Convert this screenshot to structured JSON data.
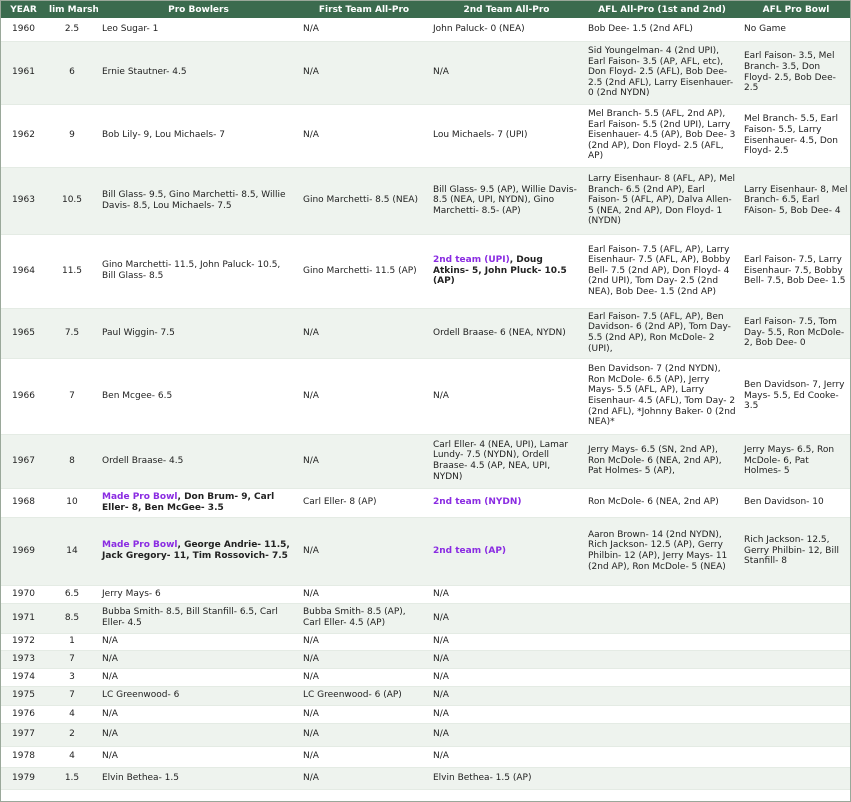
{
  "headers": [
    "YEAR",
    "lim Marshal",
    "Pro Bowlers",
    "First Team All-Pro",
    "2nd Team All-Pro",
    "AFL All-Pro (1st and 2nd)",
    "AFL Pro Bowl"
  ],
  "rows": [
    {
      "year": "1960",
      "sacks": "2.5",
      "pro_bowl": "Leo Sugar- 1",
      "first": "N/A",
      "second": "John Paluck- 0 (NEA)",
      "afl_allpro": "Bob Dee- 1.5 (2nd AFL)",
      "afl_bowl": "No Game",
      "h": 23
    },
    {
      "year": "1961",
      "sacks": "6",
      "pro_bowl": "Ernie Stautner- 4.5",
      "first": "N/A",
      "second": "N/A",
      "afl_allpro": "Sid Youngelman- 4 (2nd UPI), Earl Faison- 3.5 (AP, AFL, etc), Don Floyd- 2.5 (AFL), Bob Dee- 2.5 (2nd AFL), Larry Eisenhauer- 0 (2nd NYDN)",
      "afl_bowl": "Earl Faison- 3.5, Mel Branch- 3.5, Don Floyd- 2.5, Bob Dee- 2.5",
      "h": 63
    },
    {
      "year": "1962",
      "sacks": "9",
      "pro_bowl": "Bob Lily- 9, Lou Michaels- 7",
      "first": "N/A",
      "second": "Lou Michaels- 7 (UPI)",
      "afl_allpro": "Mel Branch- 5.5 (AFL, 2nd AP), Earl Faison- 5.5 (2nd UPI), Larry Eisenhauer- 4.5 (AP), Bob Dee- 3 (2nd AP), Don Floyd- 2.5 (AFL, AP)",
      "afl_bowl": "Mel Branch- 5.5, Earl Faison- 5.5, Larry Eisenhauer- 4.5, Don Floyd- 2.5",
      "h": 63
    },
    {
      "year": "1963",
      "sacks": "10.5",
      "pro_bowl": "Bill Glass- 9.5, Gino Marchetti- 8.5, Willie Davis- 8.5, Lou Michaels- 7.5",
      "first": "Gino Marchetti- 8.5 (NEA)",
      "second": "Bill Glass- 9.5 (AP), Willie Davis- 8.5 (NEA, UPI, NYDN), Gino Marchetti- 8.5- (AP)",
      "afl_allpro": "Larry Eisenhaur- 8 (AFL, AP), Mel Branch- 6.5 (2nd AP), Earl Faison- 5 (AFL, AP), Dalva Allen- 5 (NEA, 2nd AP), Don Floyd- 1 (NYDN)",
      "afl_bowl": "Larry Eisenhaur- 8, Mel Branch- 6.5, Earl FAison- 5, Bob Dee- 4",
      "h": 67
    },
    {
      "year": "1964",
      "sacks": "11.5",
      "pro_bowl": "Gino Marchetti- 11.5, John Paluck- 10.5, Bill Glass- 8.5",
      "first": "Gino Marchetti- 11.5 (AP)",
      "second_parts": [
        "2nd team (UPI)",
        ", Doug Atkins- 5, John Pluck- 10.5 (AP)"
      ],
      "afl_allpro": "Earl Faison- 7.5 (AFL, AP), Larry Eisenhaur- 7.5 (AFL, AP), Bobby Bell- 7.5 (2nd AP), Don Floyd- 4 (2nd UPI), Tom Day- 2.5 (2nd NEA), Bob Dee- 1.5 (2nd AP)",
      "afl_bowl": "Earl Faison- 7.5, Larry Eisenhaur- 7.5, Bobby Bell- 7.5, Bob Dee- 1.5",
      "h": 74
    },
    {
      "year": "1965",
      "sacks": "7.5",
      "pro_bowl": "Paul Wiggin- 7.5",
      "first": "N/A",
      "second": "Ordell Braase- 6 (NEA, NYDN)",
      "afl_allpro": "Earl Faison- 7.5 (AFL, AP), Ben Davidson- 6 (2nd AP), Tom Day- 5.5 (2nd AP), Ron McDole- 2 (UPI),",
      "afl_bowl": "Earl Faison- 7.5, Tom Day- 5.5, Ron McDole- 2, Bob Dee- 0",
      "h": 50
    },
    {
      "year": "1966",
      "sacks": "7",
      "pro_bowl": "Ben Mcgee- 6.5",
      "first": "N/A",
      "second": "N/A",
      "afl_allpro": "Ben Davidson- 7 (2nd NYDN), Ron McDole- 6.5 (AP), Jerry Mays- 5.5 (AFL, AP), Larry Eisenhaur- 4.5 (AFL), Tom Day- 2 (2nd AFL), *Johnny Baker- 0 (2nd NEA)*",
      "afl_bowl": "Ben Davidson- 7, Jerry Mays- 5.5, Ed Cooke- 3.5",
      "h": 76
    },
    {
      "year": "1967",
      "sacks": "8",
      "pro_bowl": "Ordell Braase- 4.5",
      "first": "N/A",
      "second": "Carl Eller- 4 (NEA, UPI), Lamar Lundy- 7.5 (NYDN), Ordell Braase- 4.5 (AP, NEA, UPI, NYDN)",
      "afl_allpro": "Jerry Mays- 6.5 (SN, 2nd AP), Ron McDole- 6 (NEA, 2nd AP), Pat Holmes- 5 (AP),",
      "afl_bowl": "Jerry Mays- 6.5, Ron McDole- 6, Pat Holmes- 5",
      "h": 54
    },
    {
      "year": "1968",
      "sacks": "10",
      "pro_bowl_parts": [
        "Made Pro Bowl",
        ", Don Brum- 9, Carl Eller- 8, Ben McGee- 3.5"
      ],
      "first": "Carl Eller- 8 (AP)",
      "second_hl": "2nd team (NYDN)",
      "afl_allpro": "Ron McDole- 6 (NEA, 2nd AP)",
      "afl_bowl": "Ben Davidson- 10",
      "h": 29
    },
    {
      "year": "1969",
      "sacks": "14",
      "pro_bowl_parts": [
        "Made Pro Bowl",
        ", George Andrie- 11.5, Jack Gregory- 11, Tim Rossovich- 7.5"
      ],
      "first": "N/A",
      "second_hl": "2nd team (AP)",
      "afl_allpro": "Aaron Brown- 14 (2nd NYDN), Rich Jackson- 12.5 (AP), Gerry Philbin- 12 (AP), Jerry Mays- 11 (2nd AP), Ron McDole- 5 (NEA)",
      "afl_bowl": "Rich Jackson- 12.5, Gerry Philbin- 12, Bill Stanfill- 8",
      "h": 68
    },
    {
      "year": "1970",
      "sacks": "6.5",
      "pro_bowl": "Jerry Mays- 6",
      "first": "N/A",
      "second": "N/A",
      "afl_allpro": "",
      "afl_bowl": "",
      "h": 18
    },
    {
      "year": "1971",
      "sacks": "8.5",
      "pro_bowl": "Bubba Smith- 8.5, Bill Stanfill- 6.5, Carl Eller- 4.5",
      "first": "Bubba Smith- 8.5 (AP), Carl Eller- 4.5 (AP)",
      "second": "N/A",
      "afl_allpro": "",
      "afl_bowl": "",
      "h": 30
    },
    {
      "year": "1972",
      "sacks": "1",
      "pro_bowl": "N/A",
      "first": "N/A",
      "second": "N/A",
      "afl_allpro": "",
      "afl_bowl": "",
      "h": 17
    },
    {
      "year": "1973",
      "sacks": "7",
      "pro_bowl": "N/A",
      "first": "N/A",
      "second": "N/A",
      "afl_allpro": "",
      "afl_bowl": "",
      "h": 18
    },
    {
      "year": "1974",
      "sacks": "3",
      "pro_bowl": "N/A",
      "first": "N/A",
      "second": "N/A",
      "afl_allpro": "",
      "afl_bowl": "",
      "h": 18
    },
    {
      "year": "1975",
      "sacks": "7",
      "pro_bowl": "LC Greenwood- 6",
      "first": "LC Greenwood- 6 (AP)",
      "second": "N/A",
      "afl_allpro": "",
      "afl_bowl": "",
      "h": 19
    },
    {
      "year": "1976",
      "sacks": "4",
      "pro_bowl": "N/A",
      "first": "N/A",
      "second": "N/A",
      "afl_allpro": "",
      "afl_bowl": "",
      "h": 18
    },
    {
      "year": "1977",
      "sacks": "2",
      "pro_bowl": "N/A",
      "first": "N/A",
      "second": "N/A",
      "afl_allpro": "",
      "afl_bowl": "",
      "h": 23
    },
    {
      "year": "1978",
      "sacks": "4",
      "pro_bowl": "N/A",
      "first": "N/A",
      "second": "N/A",
      "afl_allpro": "",
      "afl_bowl": "",
      "h": 21
    },
    {
      "year": "1979",
      "sacks": "1.5",
      "pro_bowl": "Elvin Bethea- 1.5",
      "first": "N/A",
      "second": "Elvin Bethea- 1.5 (AP)",
      "afl_allpro": "",
      "afl_bowl": "",
      "h": 22
    }
  ]
}
